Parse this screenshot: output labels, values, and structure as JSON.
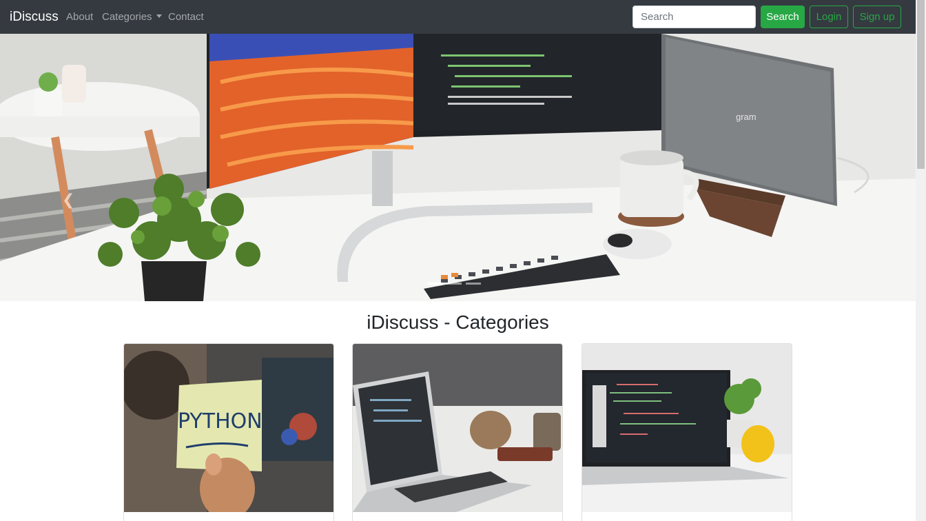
{
  "navbar": {
    "brand": "iDiscuss",
    "links": {
      "about": "About",
      "categories": "Categories",
      "contact": "Contact"
    },
    "search_placeholder": "Search",
    "search_button": "Search",
    "login_button": "Login",
    "signup_button": "Sign up",
    "bg_color": "#343a40",
    "accent_color": "#28a745"
  },
  "carousel": {
    "slide_count": 3,
    "active_slide": 1
  },
  "section": {
    "title": "iDiscuss - Categories"
  },
  "cards": [
    {
      "image_text": "PYTHON"
    },
    {
      "image_text": ""
    },
    {
      "image_text": ""
    }
  ]
}
